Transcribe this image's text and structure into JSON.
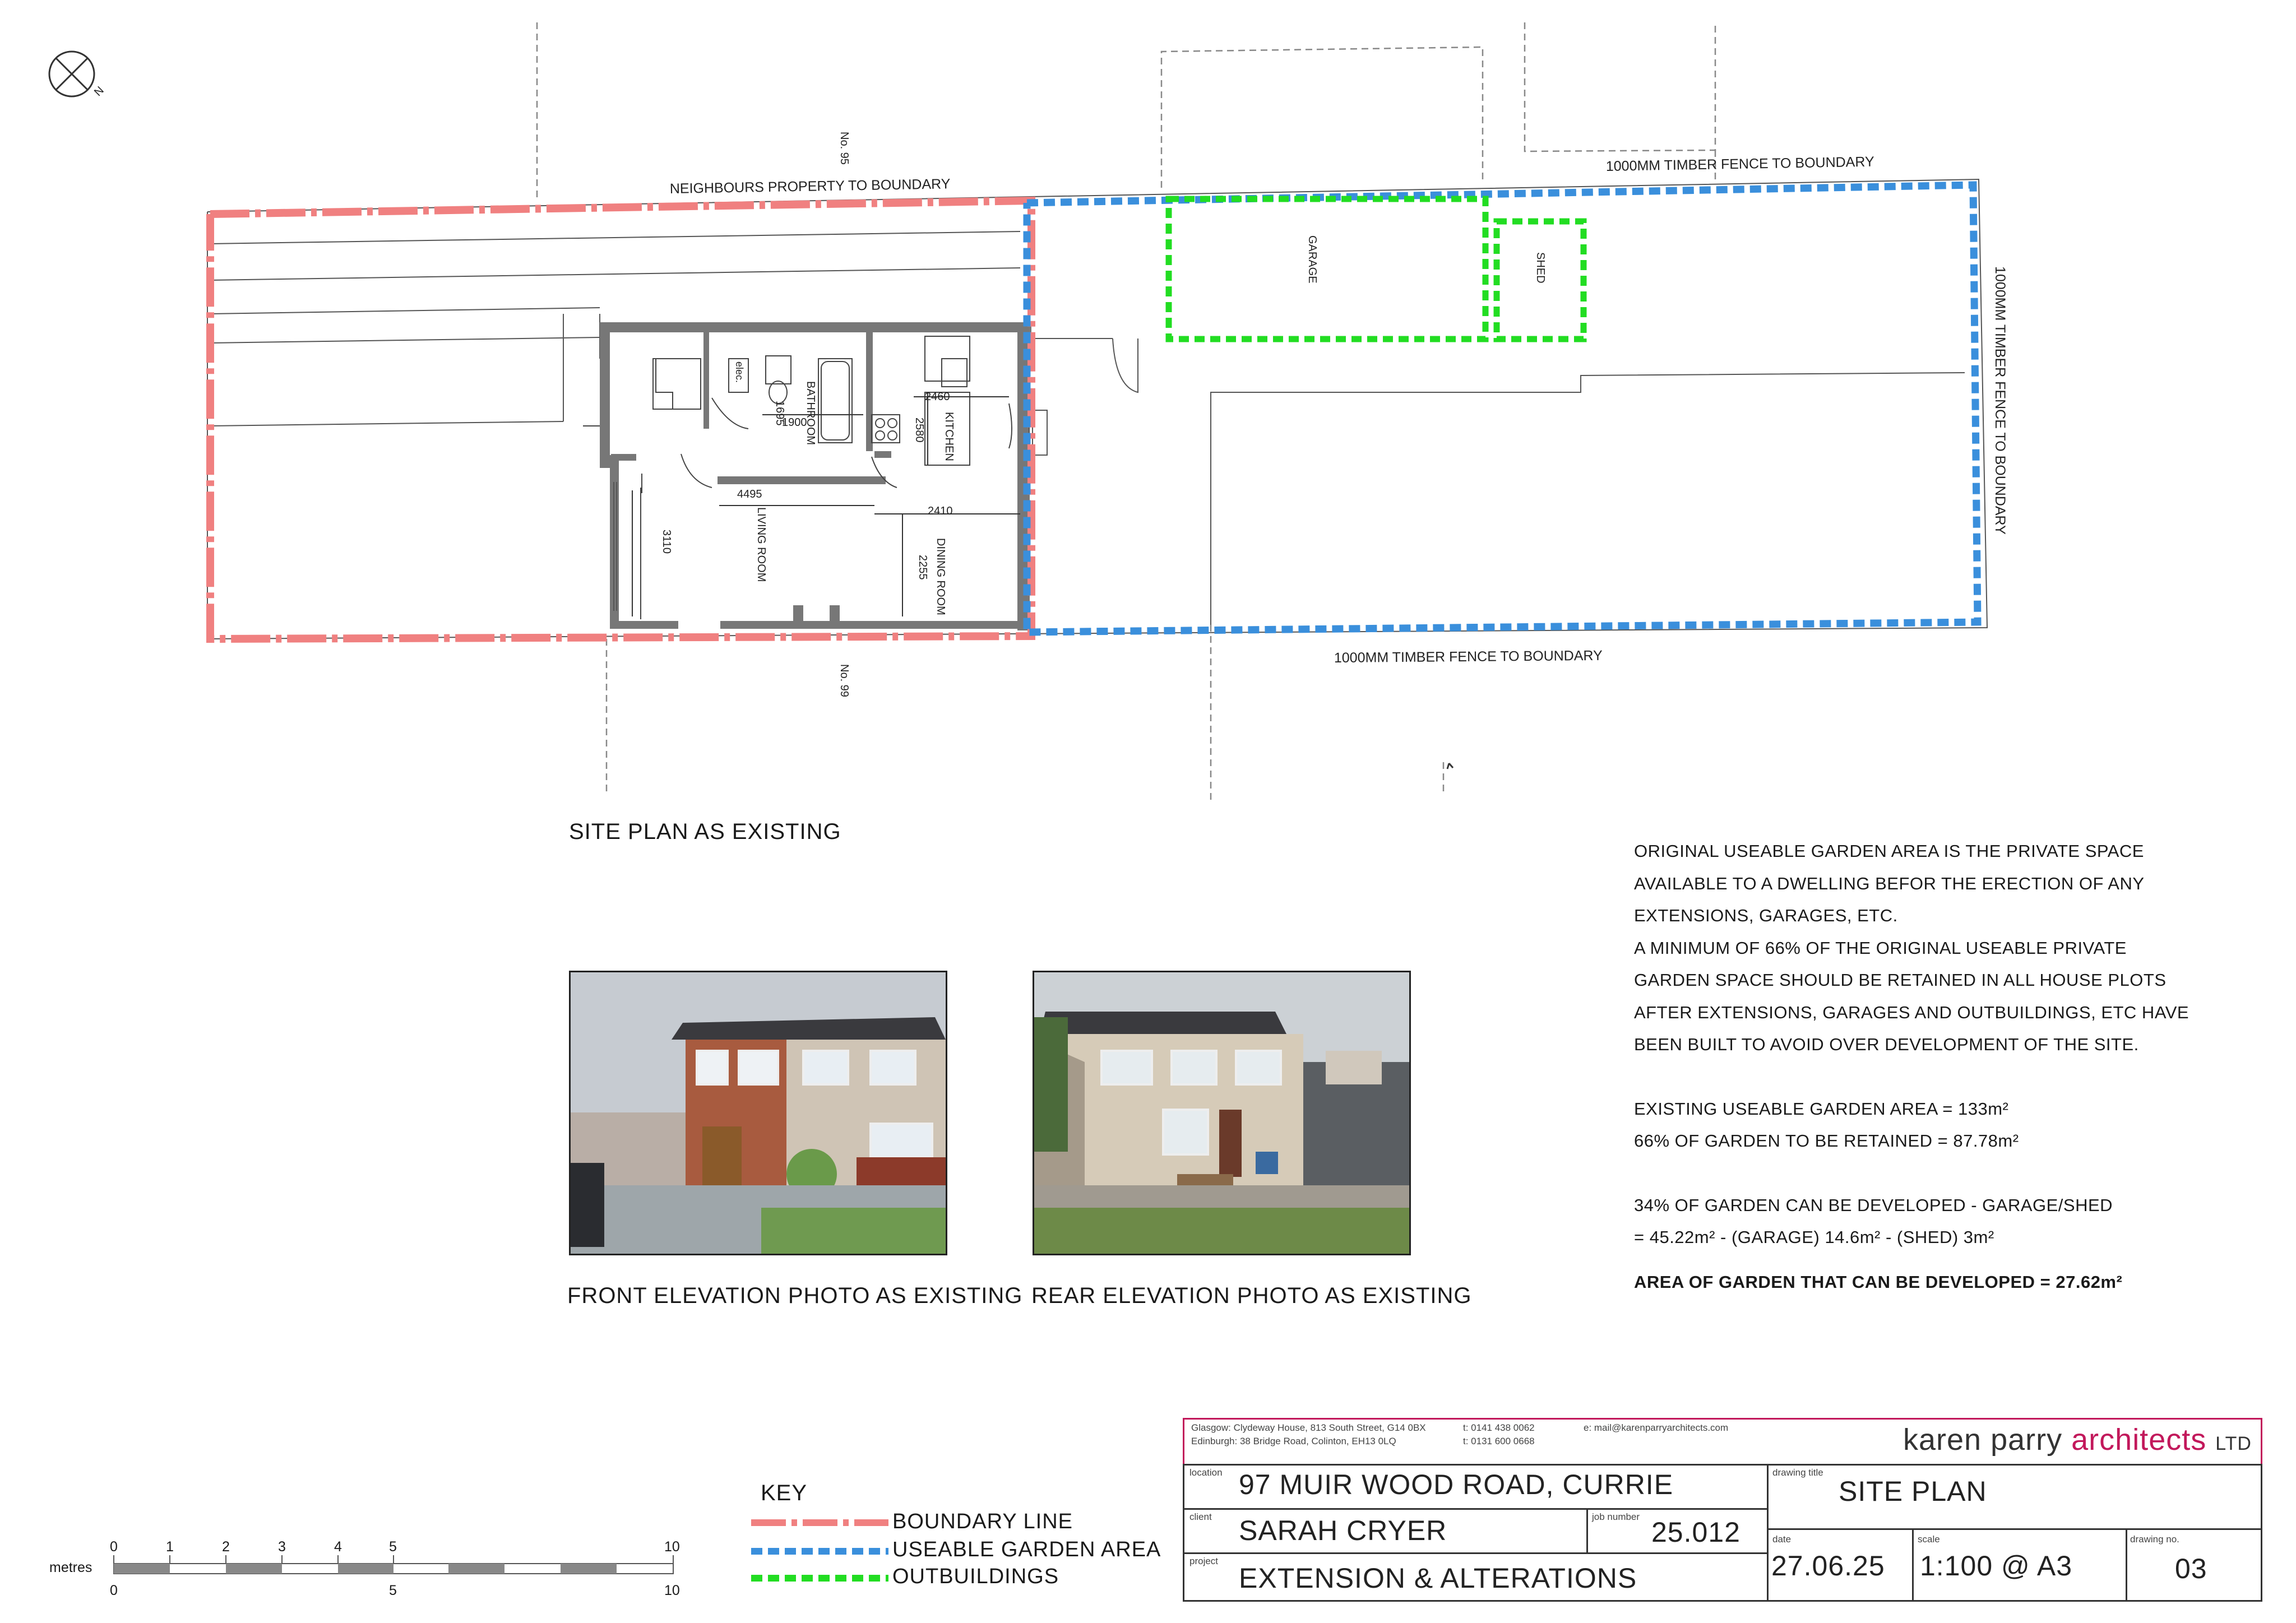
{
  "plan": {
    "title": "SITE PLAN AS EXISTING",
    "neighbour_top_no": "No. 95",
    "neighbour_bottom_no": "No. 99",
    "labels": {
      "neighbours_boundary": "NEIGHBOURS PROPERTY TO BOUNDARY",
      "fence_top": "1000MM TIMBER FENCE TO BOUNDARY",
      "fence_right": "1000MM TIMBER FENCE TO BOUNDARY",
      "fence_bottom": "1000MM TIMBER FENCE TO BOUNDARY",
      "garage": "GARAGE",
      "shed": "SHED"
    },
    "rooms": {
      "bathroom": "BATHROOM",
      "kitchen": "KITCHEN",
      "living": "LIVING ROOM",
      "dining": "DINING ROOM",
      "elec": "elec."
    },
    "dimensions": {
      "d1": "1695",
      "d2": "1900",
      "d3": "2460",
      "d4": "2580",
      "d5": "4495",
      "d6": "2410",
      "d7": "3110",
      "d8": "2255"
    },
    "compass_letter": "N"
  },
  "notes": {
    "paragraph_1": "ORIGINAL USEABLE GARDEN AREA IS THE PRIVATE SPACE AVAILABLE TO A DWELLING BEFOR THE ERECTION OF ANY EXTENSIONS, GARAGES, ETC.",
    "paragraph_2": "A MINIMUM OF 66% OF THE ORIGINAL USEABLE PRIVATE GARDEN SPACE SHOULD BE RETAINED IN ALL HOUSE PLOTS AFTER EXTENSIONS, GARAGES AND OUTBUILDINGS, ETC HAVE BEEN BUILT TO AVOID OVER DEVELOPMENT OF THE SITE.",
    "existing_area": "EXISTING USEABLE GARDEN AREA = 133m²",
    "retained": "66% OF GARDEN TO BE RETAINED = 87.78m²",
    "developable_1": "34% OF GARDEN CAN BE DEVELOPED - GARAGE/SHED",
    "developable_2": "= 45.22m² - (GARAGE) 14.6m² - (SHED) 3m²",
    "result": "AREA OF GARDEN THAT CAN BE DEVELOPED = 27.62m²"
  },
  "photos": {
    "front_caption": "FRONT ELEVATION PHOTO AS EXISTING",
    "rear_caption": "REAR ELEVATION PHOTO AS EXISTING"
  },
  "key": {
    "title": "KEY",
    "items": [
      {
        "label": "BOUNDARY LINE",
        "color": "#f08080"
      },
      {
        "label": "USEABLE GARDEN AREA",
        "color": "#3a8fdc"
      },
      {
        "label": "OUTBUILDINGS",
        "color": "#22dd22"
      }
    ]
  },
  "scale_bar": {
    "unit_label": "metres",
    "top_ticks": [
      "0",
      "1",
      "2",
      "3",
      "4",
      "5",
      "10"
    ],
    "bottom_ticks": [
      "0",
      "5",
      "10"
    ]
  },
  "title_block": {
    "office_line_1": "Glasgow: Clydeway House, 813 South Street, G14 0BX",
    "office_line_2": "Edinburgh: 38 Bridge Road, Colinton, EH13 0LQ",
    "phone_1": "t: 0141 438 0062",
    "phone_2": "t: 0131 600 0668",
    "email": "e: mail@karenparryarchitects.com",
    "brand_name": "karen parry",
    "brand_accent": "architects",
    "brand_suffix": "LTD",
    "location_label": "location",
    "location_value": "97 MUIR WOOD ROAD, CURRIE",
    "client_label": "client",
    "client_value": "SARAH CRYER",
    "job_label": "job number",
    "job_value": "25.012",
    "project_label": "project",
    "project_value": "EXTENSION & ALTERATIONS",
    "drawing_title_label": "drawing title",
    "drawing_title_value": "SITE PLAN",
    "date_label": "date",
    "date_value": "27.06.25",
    "scale_label": "scale",
    "scale_value": "1:100 @ A3",
    "drawing_no_label": "drawing no.",
    "drawing_no_value": "03",
    "accent_color": "#c2185b"
  }
}
